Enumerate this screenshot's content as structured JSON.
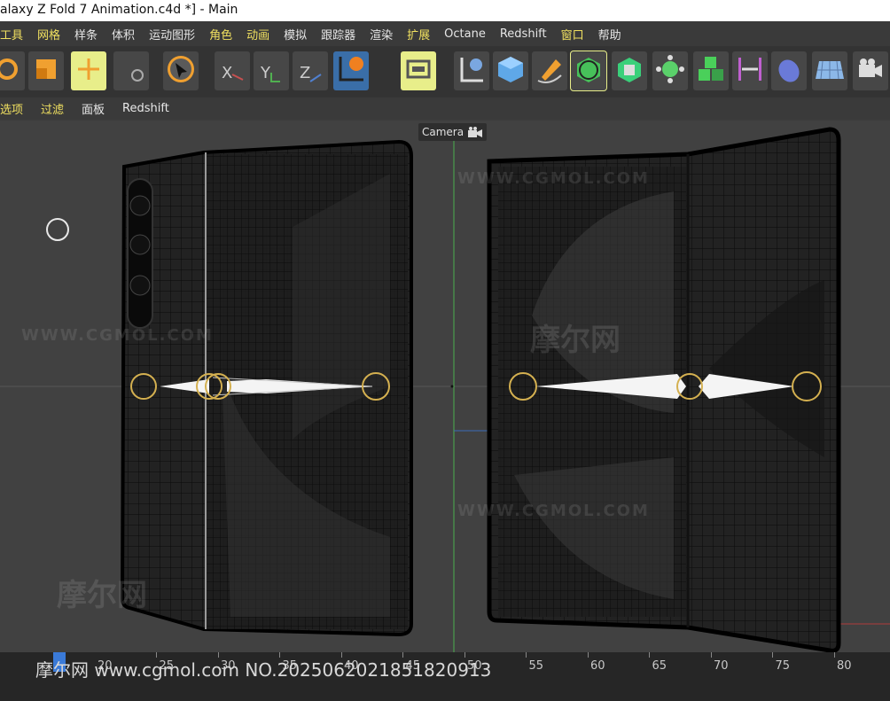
{
  "window": {
    "title": "alaxy Z Fold 7 Animation.c4d *] - Main"
  },
  "menu": {
    "items": [
      {
        "label": "工具",
        "hl": true
      },
      {
        "label": "网格",
        "hl": true
      },
      {
        "label": "样条",
        "hl": false
      },
      {
        "label": "体积",
        "hl": false
      },
      {
        "label": "运动图形",
        "hl": false
      },
      {
        "label": "角色",
        "hl": true
      },
      {
        "label": "动画",
        "hl": true
      },
      {
        "label": "模拟",
        "hl": false
      },
      {
        "label": "跟踪器",
        "hl": false
      },
      {
        "label": "渲染",
        "hl": false
      },
      {
        "label": "扩展",
        "hl": true
      },
      {
        "label": "Octane",
        "hl": false
      },
      {
        "label": "Redshift",
        "hl": false
      },
      {
        "label": "窗口",
        "hl": true
      },
      {
        "label": "帮助",
        "hl": false
      }
    ]
  },
  "toolbar": {
    "axis_x": "X",
    "axis_y": "Y",
    "axis_z": "Z",
    "tools": [
      "rotate-icon",
      "scale-icon",
      "move-icon",
      "live-select-icon",
      "x-axis-lock-icon",
      "y-axis-lock-icon",
      "z-axis-lock-icon",
      "world-coordinate-icon",
      "render-view-icon",
      "spline-pen-icon",
      "cube-icon",
      "pen-icon",
      "generator-icon",
      "deformer-icon",
      "mograph-icon",
      "cloner-icon",
      "field-icon",
      "light-icon",
      "floor-icon",
      "camera-icon"
    ]
  },
  "viewmenu": {
    "items": [
      {
        "label": "选项",
        "hl": true
      },
      {
        "label": "过滤",
        "hl": true
      },
      {
        "label": "面板",
        "hl": false
      },
      {
        "label": "Redshift",
        "hl": false
      }
    ]
  },
  "viewport": {
    "camera_label": "Camera",
    "watermark_url": "WWW.CGMOL.COM",
    "watermark_cn": "摩尔网"
  },
  "timeline": {
    "ticks": [
      "20",
      "25",
      "30",
      "35",
      "40",
      "45",
      "50",
      "55",
      "60",
      "65",
      "70",
      "75",
      "80"
    ],
    "watermark": "摩尔网 www.cgmol.com NO.20250620218518209​13"
  }
}
